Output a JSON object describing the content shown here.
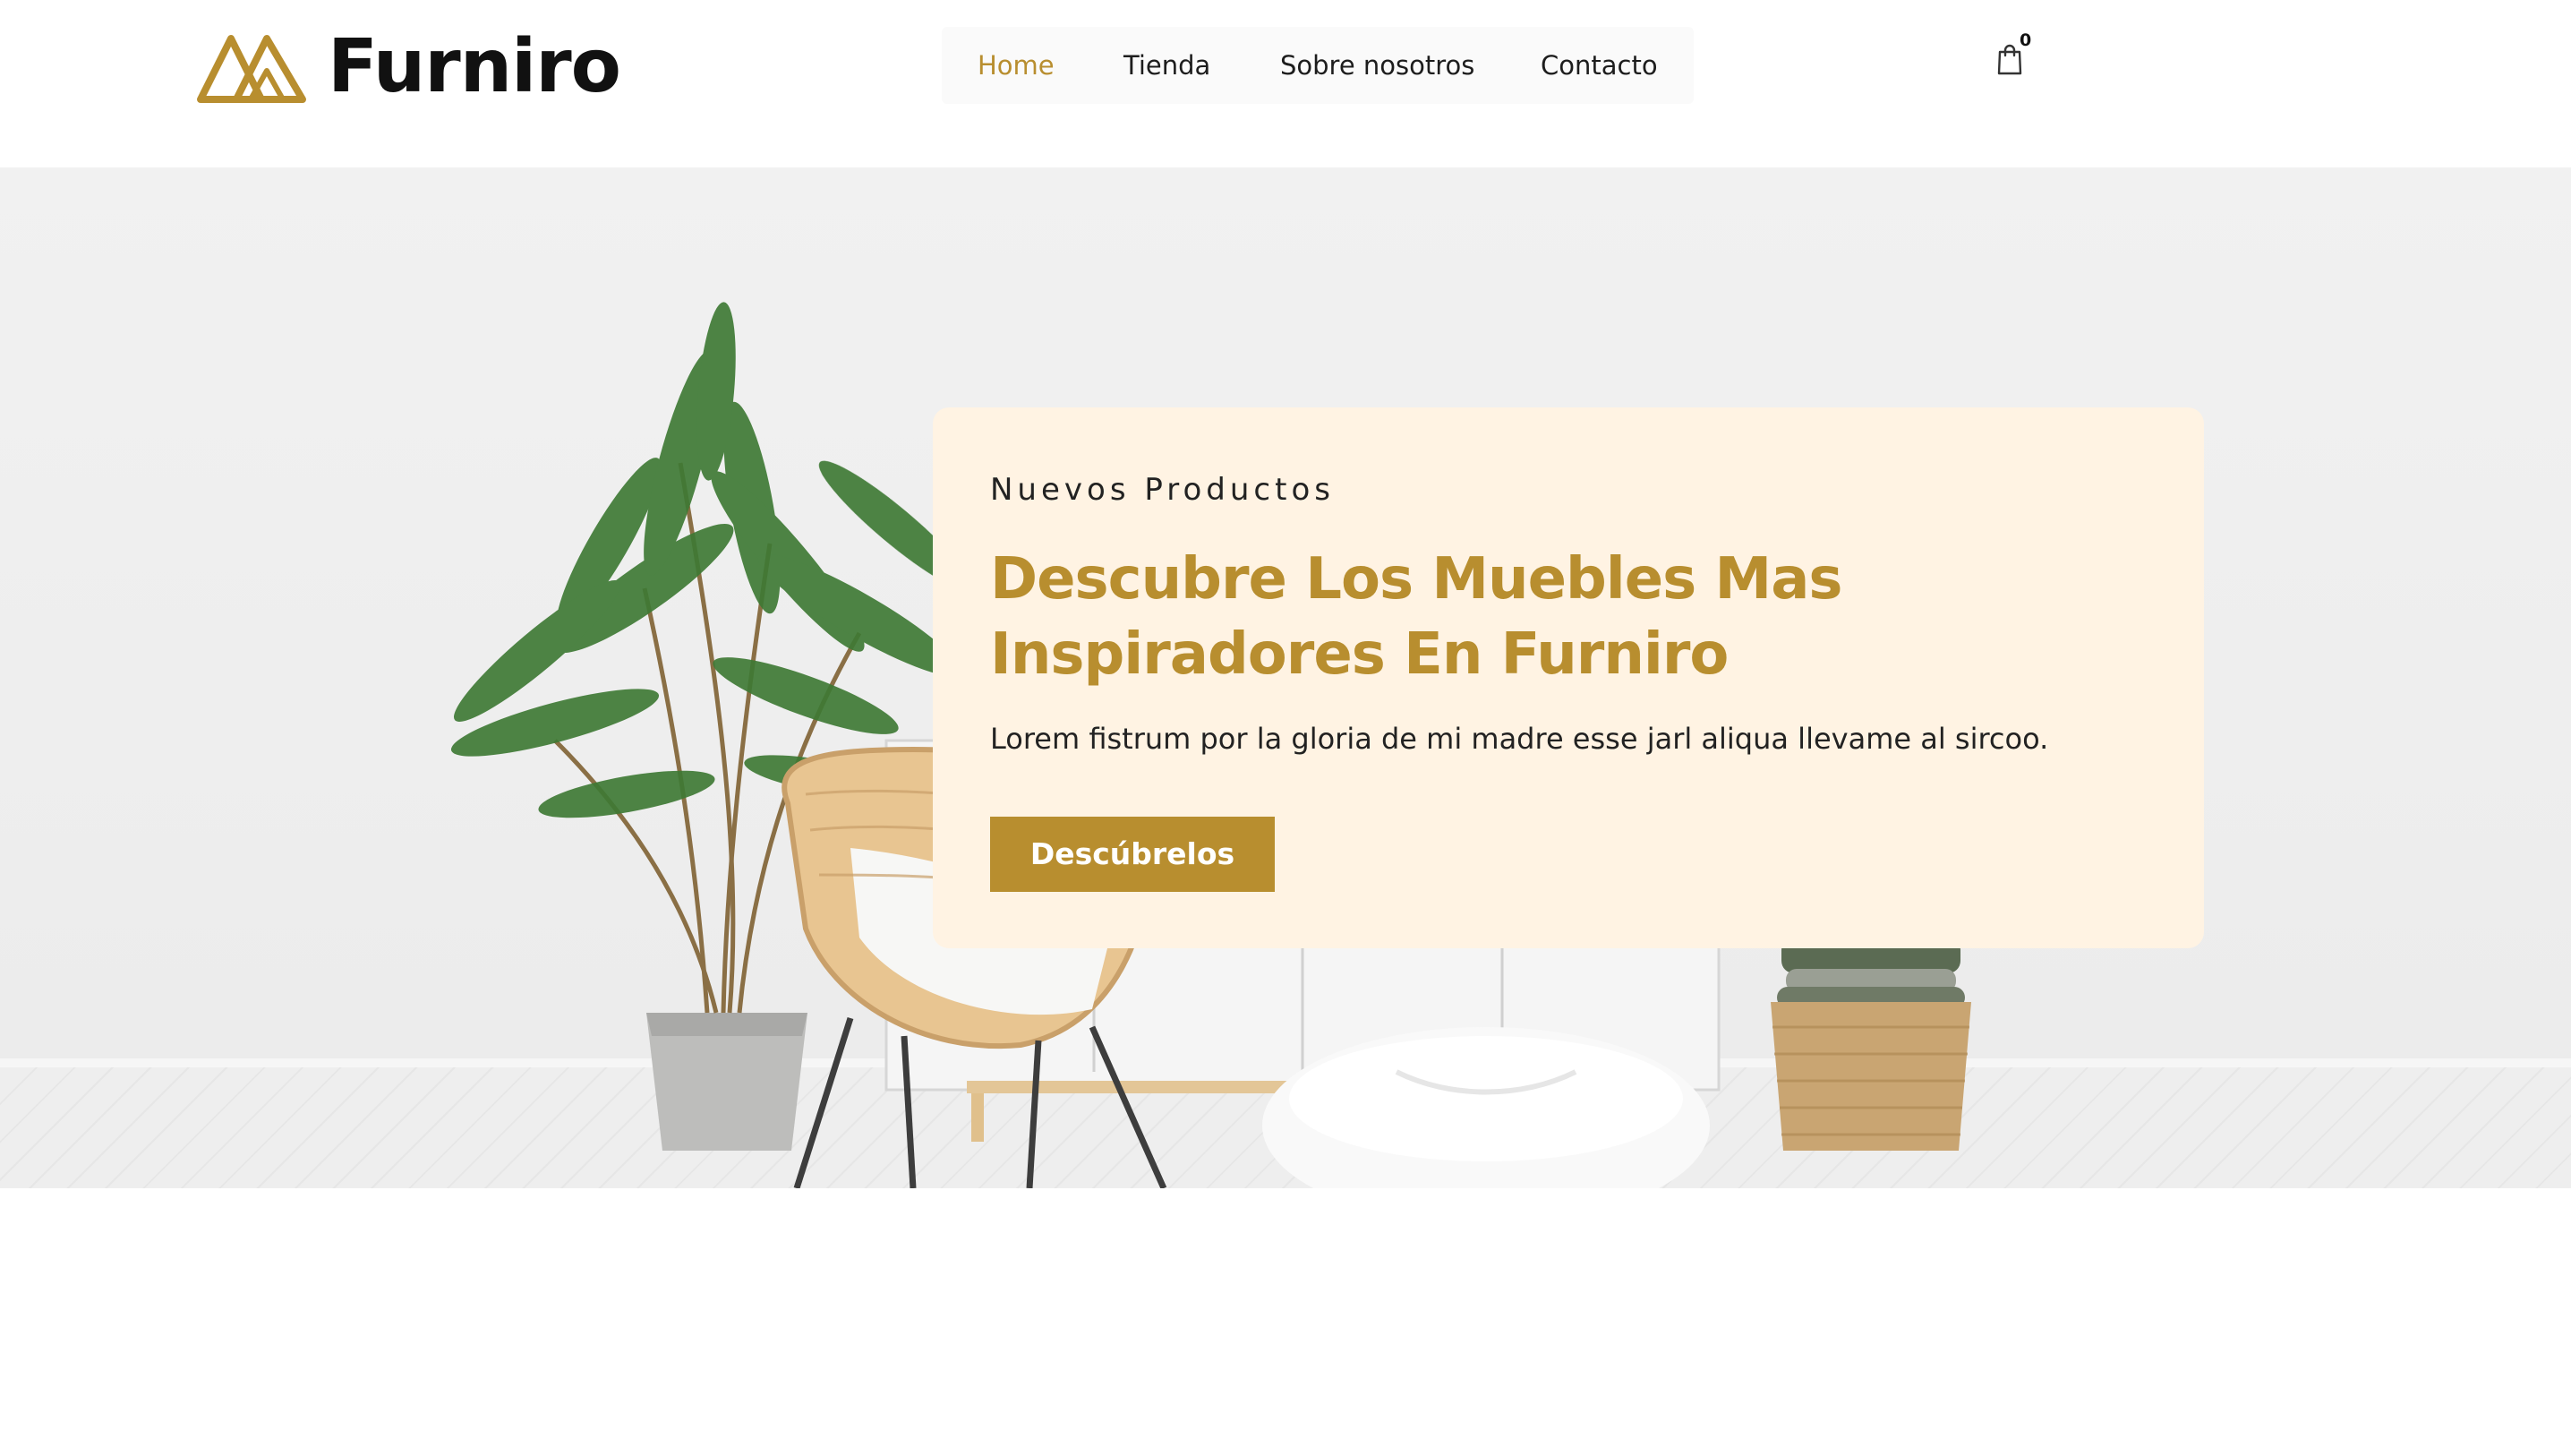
{
  "header": {
    "logo_text": "Furniro",
    "nav": [
      {
        "label": "Home",
        "active": true
      },
      {
        "label": "Tienda",
        "active": false
      },
      {
        "label": "Sobre nosotros",
        "active": false
      },
      {
        "label": "Contacto",
        "active": false
      }
    ],
    "cart": {
      "icon": "shopping-bag-icon",
      "count": "0"
    }
  },
  "hero": {
    "eyebrow": "Nuevos Productos",
    "title": "Descubre Los Muebles Mas Inspiradores En Furniro",
    "description": "Lorem fistrum por la gloria de mi madre esse jarl aliqua llevame al sircoo.",
    "cta_label": "Descúbrelos"
  },
  "colors": {
    "accent": "#b88e2f",
    "card_background": "#fff3e3",
    "text_dark": "#222222"
  }
}
